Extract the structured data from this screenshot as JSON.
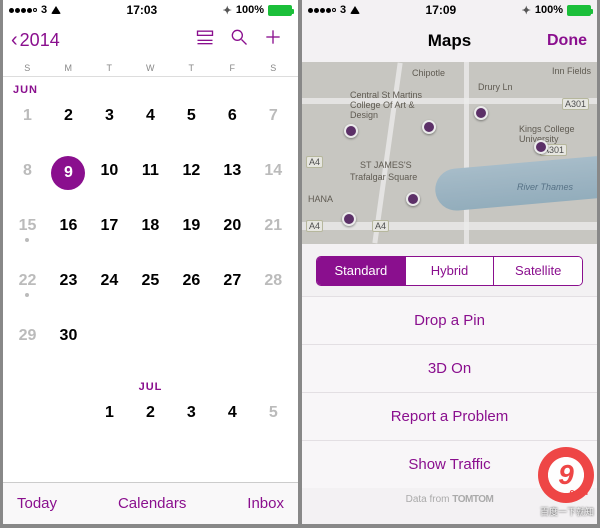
{
  "status_left": {
    "carrier": "3",
    "wifi": true,
    "time": "17:03"
  },
  "status_right": {
    "carrier": "3",
    "wifi": true,
    "time": "17:09"
  },
  "status_common": {
    "bluetooth": true,
    "battery_pct": "100%"
  },
  "calendar": {
    "back_label": "2014",
    "weekdays": [
      "S",
      "M",
      "T",
      "W",
      "T",
      "F",
      "S"
    ],
    "month_label": "JUN",
    "next_month_label": "JUL",
    "weeks": [
      [
        {
          "d": 1,
          "dim": true
        },
        {
          "d": 2,
          "bold": true
        },
        {
          "d": 3,
          "bold": true
        },
        {
          "d": 4,
          "bold": true
        },
        {
          "d": 5,
          "bold": true
        },
        {
          "d": 6,
          "bold": true
        },
        {
          "d": 7,
          "dim": true
        }
      ],
      [
        {
          "d": 8,
          "dim": true
        },
        {
          "d": 9,
          "sel": true
        },
        {
          "d": 10,
          "bold": true
        },
        {
          "d": 11,
          "bold": true
        },
        {
          "d": 12,
          "bold": true
        },
        {
          "d": 13,
          "bold": true
        },
        {
          "d": 14,
          "dim": true
        }
      ],
      [
        {
          "d": 15,
          "dim": true,
          "dot": true
        },
        {
          "d": 16,
          "bold": true
        },
        {
          "d": 17,
          "bold": true
        },
        {
          "d": 18,
          "bold": true
        },
        {
          "d": 19,
          "bold": true
        },
        {
          "d": 20,
          "bold": true
        },
        {
          "d": 21,
          "dim": true
        }
      ],
      [
        {
          "d": 22,
          "dim": true,
          "dot": true
        },
        {
          "d": 23,
          "bold": true
        },
        {
          "d": 24,
          "bold": true
        },
        {
          "d": 25,
          "bold": true
        },
        {
          "d": 26,
          "bold": true
        },
        {
          "d": 27,
          "bold": true
        },
        {
          "d": 28,
          "dim": true
        }
      ],
      [
        {
          "d": 29,
          "dim": true
        },
        {
          "d": 30,
          "bold": true
        },
        null,
        null,
        null,
        null,
        null
      ]
    ],
    "next_weeks": [
      [
        null,
        null,
        {
          "d": 1,
          "bold": true
        },
        {
          "d": 2,
          "bold": true
        },
        {
          "d": 3,
          "bold": true
        },
        {
          "d": 4,
          "bold": true
        },
        {
          "d": 5,
          "dim": true
        }
      ]
    ],
    "footer": {
      "today": "Today",
      "calendars": "Calendars",
      "inbox": "Inbox"
    }
  },
  "maps": {
    "title": "Maps",
    "done": "Done",
    "segments": [
      "Standard",
      "Hybrid",
      "Satellite"
    ],
    "segment_active": 0,
    "options": [
      "Drop a Pin",
      "3D On",
      "Report a Problem",
      "Show Traffic"
    ],
    "attribution_prefix": "Data from ",
    "attribution_brand": "TOMTOM",
    "road_labels": [
      "A4",
      "A301",
      "A4",
      "A301",
      "A4"
    ],
    "poi_labels": [
      "Chipotle",
      "Central St Martins College Of Art & Design",
      "ST JAMES'S",
      "Trafalgar Square",
      "HANA",
      "Inn Fields",
      "Drury Ln",
      "Kings College University",
      "River Thames"
    ]
  },
  "watermark": {
    "logo_text": "9",
    "logo_suffix": ".com",
    "tagline": "百度一下就知"
  }
}
